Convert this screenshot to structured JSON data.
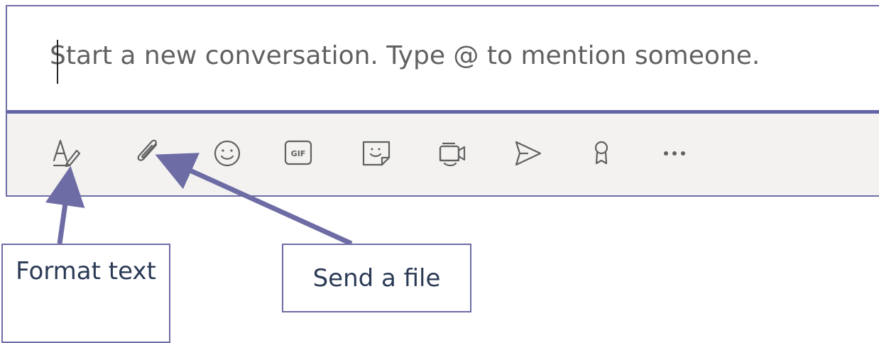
{
  "compose": {
    "placeholder": "Start a new conversation. Type @ to mention someone.",
    "value": ""
  },
  "toolbar": {
    "buttons": [
      {
        "name": "format",
        "icon": "format-text-icon"
      },
      {
        "name": "attach",
        "icon": "paperclip-icon"
      },
      {
        "name": "emoji",
        "icon": "emoji-icon"
      },
      {
        "name": "gif",
        "icon": "gif-icon",
        "label": "GIF"
      },
      {
        "name": "sticker",
        "icon": "sticker-icon"
      },
      {
        "name": "meet-now",
        "icon": "video-camera-icon"
      },
      {
        "name": "stream",
        "icon": "stream-icon"
      },
      {
        "name": "praise",
        "icon": "badge-icon"
      },
      {
        "name": "more",
        "icon": "more-options-icon"
      }
    ]
  },
  "callouts": {
    "format_text": "Format text",
    "send_file": "Send a file"
  },
  "colors": {
    "accent": "#6264a7",
    "callout_border": "#6e6ca4",
    "arrow": "#6e6ca4",
    "icon": "#616161",
    "toolbar_bg": "#f3f2f1"
  }
}
